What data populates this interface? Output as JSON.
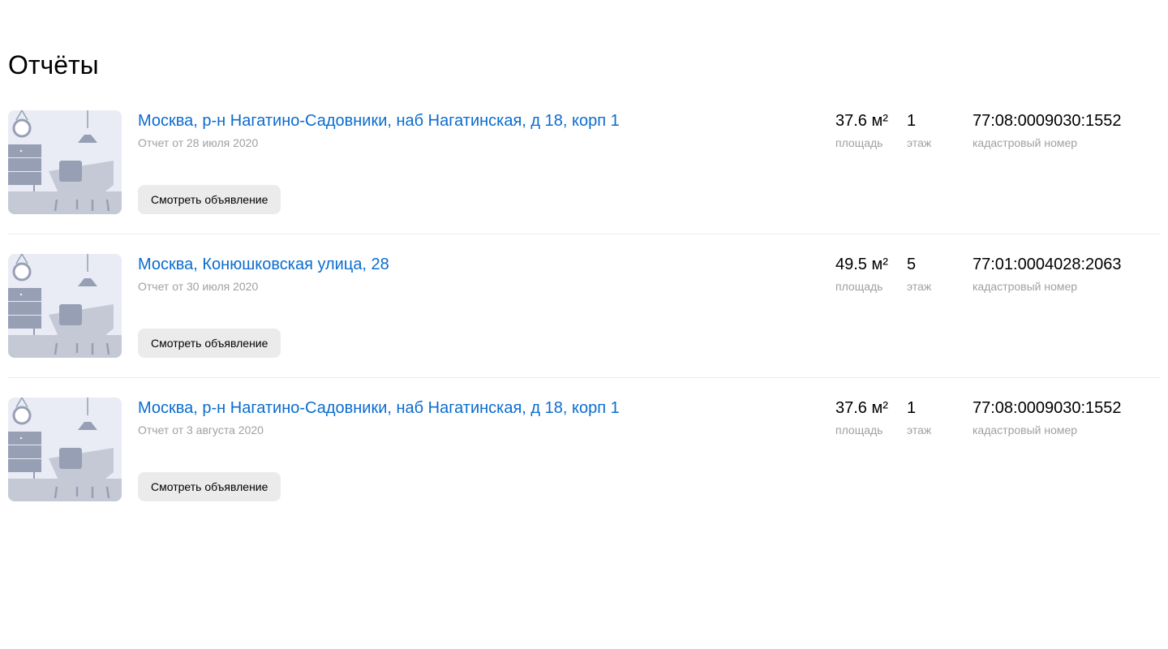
{
  "page": {
    "title": "Отчёты"
  },
  "labels": {
    "area": "площадь",
    "floor": "этаж",
    "cadastral": "кадастровый номер",
    "view_button": "Смотреть объявление"
  },
  "colors": {
    "link": "#0a6ccf",
    "muted_text": "#a0a0a0",
    "button_bg": "#ebebeb",
    "thumb_bg": "#e9ecf4",
    "thumb_furniture": "#979fb5",
    "thumb_floor": "#c5c9d6"
  },
  "reports": [
    {
      "address": "Москва, р-н Нагатино-Садовники, наб Нагатинская, д 18, корп 1",
      "date": "Отчет от 28 июля 2020",
      "area": "37.6 м²",
      "floor": "1",
      "cadastral": "77:08:0009030:1552",
      "thumbnail_icon": "room-interior-illustration"
    },
    {
      "address": "Москва, Конюшковская улица, 28",
      "date": "Отчет от 30 июля 2020",
      "area": "49.5 м²",
      "floor": "5",
      "cadastral": "77:01:0004028:2063",
      "thumbnail_icon": "room-interior-illustration"
    },
    {
      "address": "Москва, р-н Нагатино-Садовники, наб Нагатинская, д 18, корп 1",
      "date": "Отчет от 3 августа 2020",
      "area": "37.6 м²",
      "floor": "1",
      "cadastral": "77:08:0009030:1552",
      "thumbnail_icon": "room-interior-illustration"
    }
  ]
}
